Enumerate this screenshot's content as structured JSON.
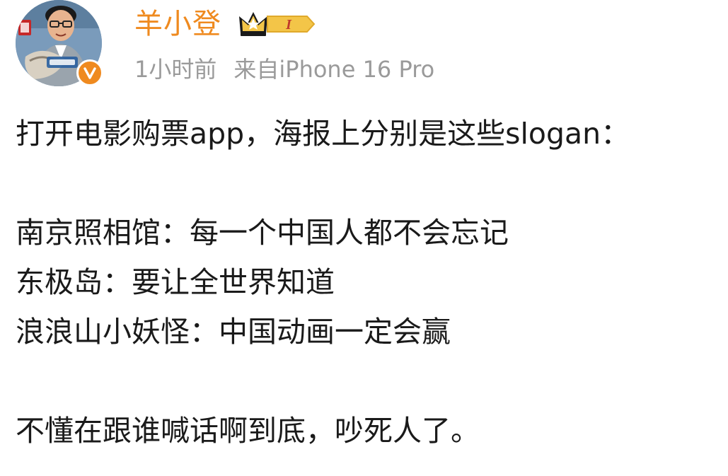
{
  "post": {
    "author": {
      "name": "羊小登",
      "vip_level": "I",
      "verified": true
    },
    "meta": {
      "time": "1小时前",
      "source": "来自iPhone 16 Pro"
    },
    "body": {
      "intro": "打开电影购票app，海报上分别是这些slogan：",
      "slogans": [
        "南京照相馆：每一个中国人都不会忘记",
        "东极岛：要让全世界知道",
        "浪浪山小妖怪：中国动画一定会赢"
      ],
      "closing": "不懂在跟谁喊话啊到底，吵死人了。"
    }
  },
  "colors": {
    "username": "#ef8a1f",
    "meta": "#9a9a9a",
    "text": "#1a1a1a",
    "badge_orange": "#ef8a1f",
    "vip_gold": "#f3c548"
  },
  "icons": {
    "verified": "verified-v-icon",
    "vip": "crown-vip-icon"
  }
}
